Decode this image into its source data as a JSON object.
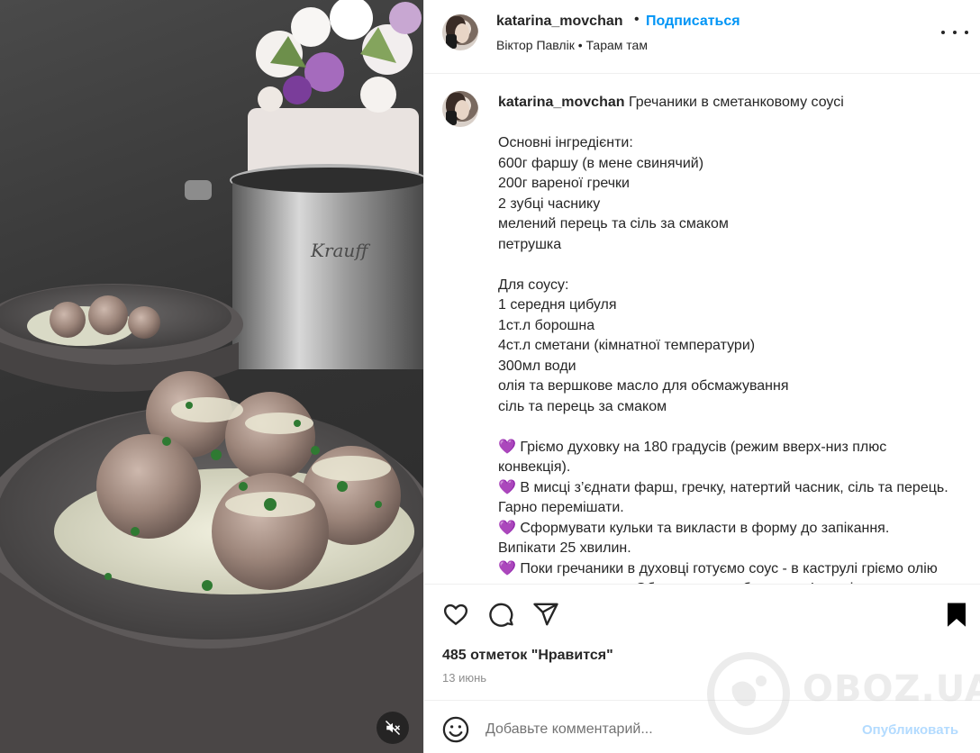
{
  "header": {
    "username": "katarina_movchan",
    "separator": "•",
    "follow_label": "Подписаться",
    "subtitle": "Віктор Павлік • Тарам там"
  },
  "caption": {
    "username": "katarina_movchan",
    "title": "Гречаники в сметанковому соусі",
    "body": "Основні інгредієнти:\n600г фаршу (в мене свинячий)\n200г вареної гречки\n2 зубці часнику\nмелений перець та сіль за смаком\nпетрушка\n\nДля соусу:\n1 середня цибуля\n1ст.л борошна\n4ст.л сметани (кімнатної температури)\n300мл води\nолія та вершкове масло для обсмажування\nсіль та перець за смаком\n\n💜 Гріємо духовку на 180 градусів (режим вверх-низ плюс конвекція).\n💜 В мисці з’єднати фарш, гречку, натертий часник, сіль та перець. Гарно перемішати.\n💜 Сформувати кульки та викласти в форму до запікання. Випікати 25 хвилин.\n💜 Поки гречаники в духовці готуємо соус - в каструлі гріємо олію та вершкове масло. Обсмажуємо цибулю до м’якості."
  },
  "actions": {
    "like_icon": "heart-icon",
    "comment_icon": "comment-icon",
    "share_icon": "share-icon",
    "save_icon": "bookmark-icon",
    "likes_text": "485 отметок \"Нравится\"",
    "date": "13 июнь"
  },
  "comment_box": {
    "placeholder": "Добавьте комментарий...",
    "publish_label": "Опубликовать"
  },
  "media": {
    "mute_icon": "sound-off-icon",
    "pot_brand": "Krauff"
  },
  "watermark": {
    "text": "OBOZ.UA"
  },
  "colors": {
    "link": "#0095f6",
    "publish_disabled": "#b3dbff",
    "text": "#262626",
    "muted": "#8e8e8e"
  }
}
